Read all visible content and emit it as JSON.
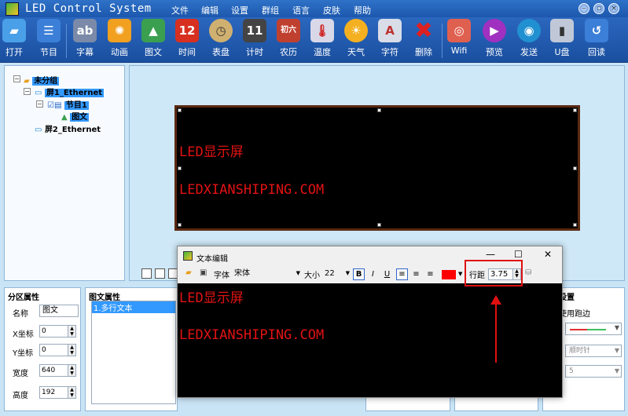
{
  "app": {
    "title": "LED Control System"
  },
  "menu": [
    "文件",
    "编辑",
    "设置",
    "群组",
    "语言",
    "皮肤",
    "帮助"
  ],
  "toolbar": [
    {
      "label": "打开",
      "icon": "folder-open-icon",
      "color": "#4aa0e8"
    },
    {
      "label": "节目",
      "icon": "program-list-icon",
      "color": "#3b7fd8"
    },
    {
      "label": "字幕",
      "icon": "subtitle-icon",
      "color": "#7a8aa8"
    },
    {
      "label": "动画",
      "icon": "animation-icon",
      "color": "#f2a020"
    },
    {
      "label": "图文",
      "icon": "image-text-icon",
      "color": "#3aa050"
    },
    {
      "label": "时间",
      "icon": "calendar-time-icon",
      "color": "#d83020"
    },
    {
      "label": "表盘",
      "icon": "clock-dial-icon",
      "color": "#d0b070"
    },
    {
      "label": "计时",
      "icon": "timer-icon",
      "color": "#444444"
    },
    {
      "label": "农历",
      "icon": "lunar-calendar-icon",
      "color": "#c04030"
    },
    {
      "label": "温度",
      "icon": "thermometer-icon",
      "color": "#d8d8e8"
    },
    {
      "label": "天气",
      "icon": "weather-sun-icon",
      "color": "#f4b020"
    },
    {
      "label": "字符",
      "icon": "character-icon",
      "color": "#d8dde8"
    },
    {
      "label": "删除",
      "icon": "delete-x-icon",
      "color": "#e02020"
    },
    {
      "label": "Wifi",
      "icon": "wifi-icon",
      "color": "#e06050"
    },
    {
      "label": "预览",
      "icon": "preview-play-icon",
      "color": "#a030c0"
    },
    {
      "label": "发送",
      "icon": "send-globe-icon",
      "color": "#2090d0"
    },
    {
      "label": "U盘",
      "icon": "usb-drive-icon",
      "color": "#c0c8d8"
    },
    {
      "label": "回读",
      "icon": "readback-icon",
      "color": "#3b7fd8"
    }
  ],
  "tree": {
    "root": "未分组",
    "screen1": "屏1_Ethernet",
    "program1": "节目1",
    "area1": "图文",
    "screen2": "屏2_Ethernet"
  },
  "screen_text": {
    "line1": "LED显示屏",
    "line2": "LEDXIANSHIPING.COM"
  },
  "partition": {
    "title": "分区属性",
    "name_label": "名称",
    "name_value": "图文",
    "x_label": "X坐标",
    "x_value": "0",
    "y_label": "Y坐标",
    "y_value": "0",
    "w_label": "宽度",
    "w_value": "640",
    "h_label": "高度",
    "h_value": "192"
  },
  "imgtext": {
    "title": "图文属性",
    "item1": "1.多行文本"
  },
  "settings": {
    "title": "设置",
    "border_label": "使用跑边",
    "direction": "顺时针",
    "speed": "5"
  },
  "dialog": {
    "title": "文本编辑",
    "font_label": "字体",
    "font_value": "宋体",
    "size_label": "大小",
    "size_value": "22",
    "bold": "B",
    "italic": "I",
    "underline": "U",
    "spacing_label": "行距",
    "spacing_value": "3.75",
    "text_color": "#ff0000"
  }
}
